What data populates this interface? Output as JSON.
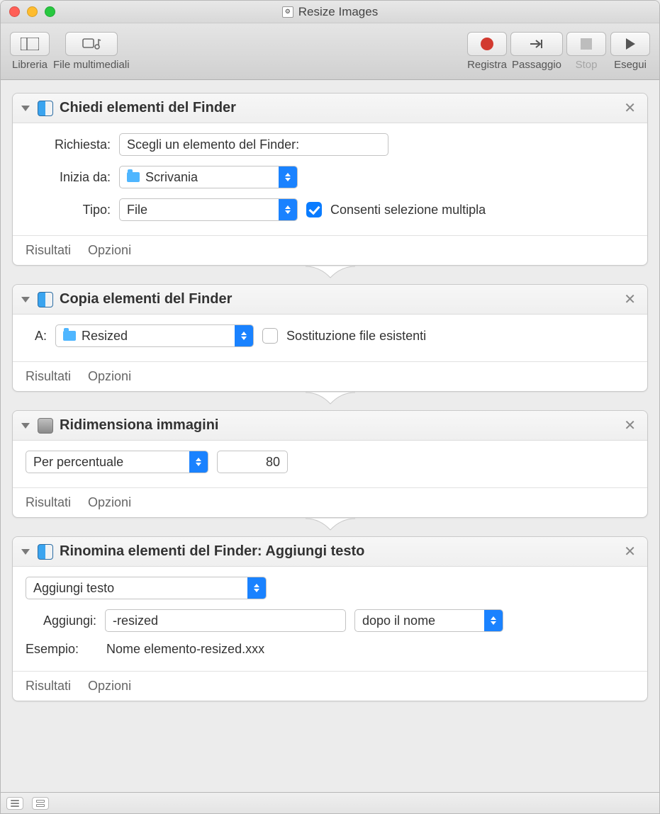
{
  "window": {
    "title": "Resize Images"
  },
  "toolbar": {
    "library": "Libreria",
    "media": "File multimediali",
    "record": "Registra",
    "step": "Passaggio",
    "stop": "Stop",
    "run": "Esegui"
  },
  "footer": {
    "results": "Risultati",
    "options": "Opzioni"
  },
  "actions": {
    "ask": {
      "title": "Chiedi elementi del Finder",
      "labels": {
        "prompt": "Richiesta:",
        "startAt": "Inizia da:",
        "type": "Tipo:"
      },
      "prompt_value": "Scegli un elemento del Finder:",
      "startAt_value": "Scrivania",
      "type_value": "File",
      "allow_multiple_label": "Consenti selezione multipla",
      "allow_multiple_checked": true
    },
    "copy": {
      "title": "Copia elementi del Finder",
      "labels": {
        "to": "A:"
      },
      "to_value": "Resized",
      "replace_label": "Sostituzione file esistenti",
      "replace_checked": false
    },
    "resize": {
      "title": "Ridimensiona immagini",
      "mode_value": "Per percentuale",
      "amount_value": "80"
    },
    "rename": {
      "title": "Rinomina elementi del Finder: Aggiungi testo",
      "mode_value": "Aggiungi testo",
      "labels": {
        "add": "Aggiungi:",
        "example": "Esempio:"
      },
      "add_value": "-resized",
      "position_value": "dopo il nome",
      "example_value": "Nome elemento-resized.xxx"
    }
  }
}
